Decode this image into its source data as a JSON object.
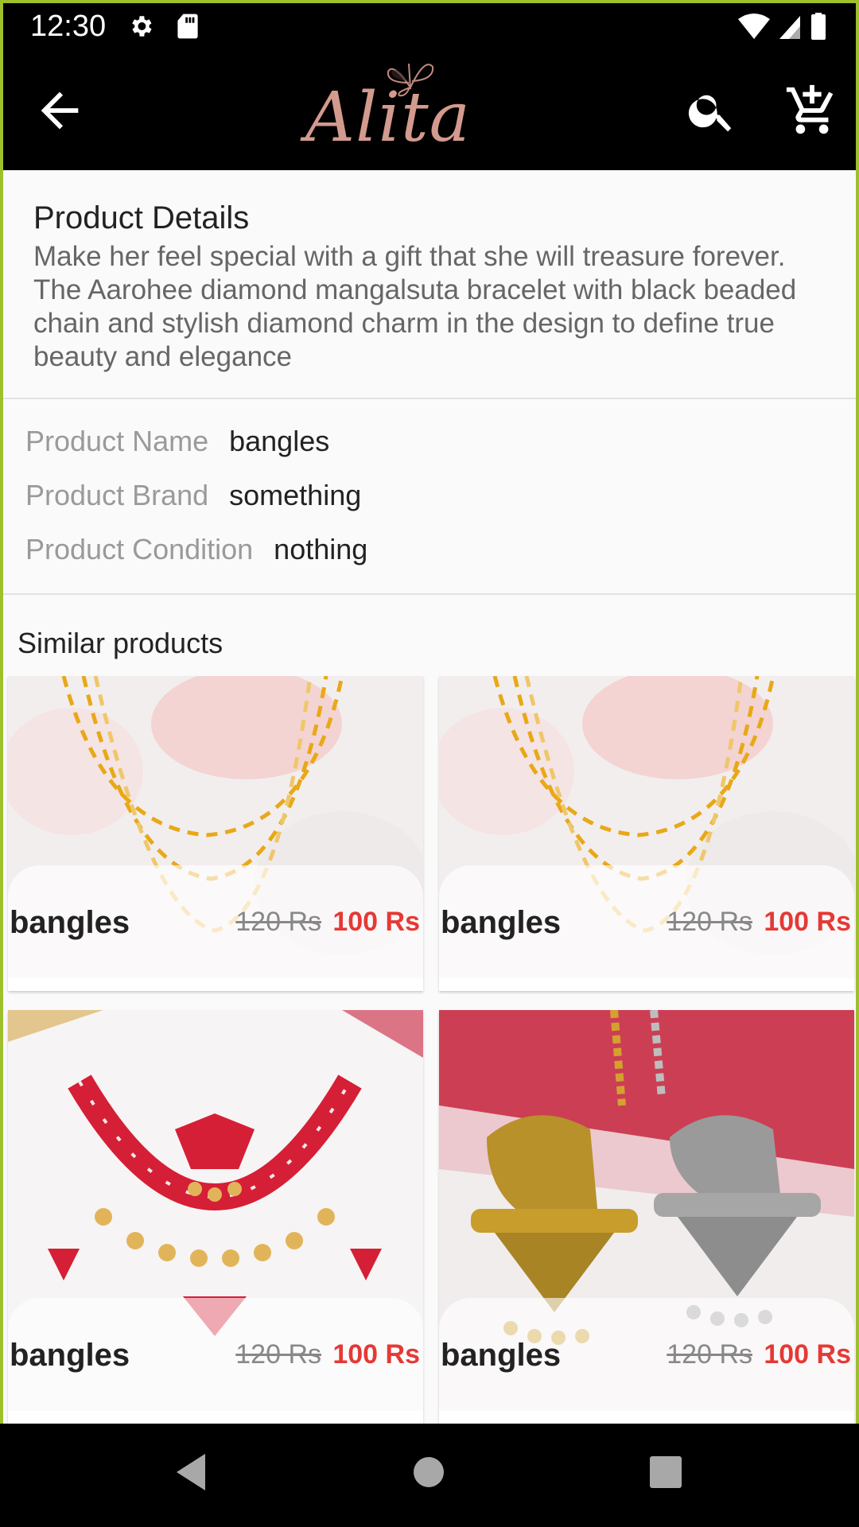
{
  "status_bar": {
    "time": "12:30",
    "left_icons": [
      "gear-icon",
      "sd-card-icon"
    ],
    "right_icons": [
      "wifi-icon",
      "signal-icon",
      "battery-icon"
    ]
  },
  "toolbar": {
    "logo_text": "Alita",
    "icons": [
      "back-arrow-icon",
      "search-icon",
      "add-to-cart-icon"
    ]
  },
  "description": {
    "title": "Product Details",
    "body": "Make her feel special with a gift that she will treasure forever. The Aarohee diamond mangalsuta bracelet with black beaded chain and stylish diamond charm in the design to define true beauty and elegance"
  },
  "specs": [
    {
      "label": "Product Name",
      "value": "bangles"
    },
    {
      "label": "Product Brand",
      "value": "something"
    },
    {
      "label": "Product Condition",
      "value": "nothing"
    }
  ],
  "similar": {
    "title": "Similar products",
    "items": [
      {
        "name": "bangles",
        "old_price": "120 Rs",
        "new_price": "100 Rs",
        "image": "gold-bead-necklace"
      },
      {
        "name": "bangles",
        "old_price": "120 Rs",
        "new_price": "100 Rs",
        "image": "gold-bead-necklace"
      },
      {
        "name": "bangles",
        "old_price": "120 Rs",
        "new_price": "100 Rs",
        "image": "red-kundan-necklace-set"
      },
      {
        "name": "bangles",
        "old_price": "120 Rs",
        "new_price": "100 Rs",
        "image": "elephant-pendants"
      }
    ]
  },
  "colors": {
    "toolbar_bg": "#000000",
    "logo": "#d39a8e",
    "sale_price": "#e53935",
    "frame_border": "#9ec02c"
  },
  "nav_bar": {
    "icons": [
      "nav-back-icon",
      "nav-home-icon",
      "nav-recents-icon"
    ]
  }
}
